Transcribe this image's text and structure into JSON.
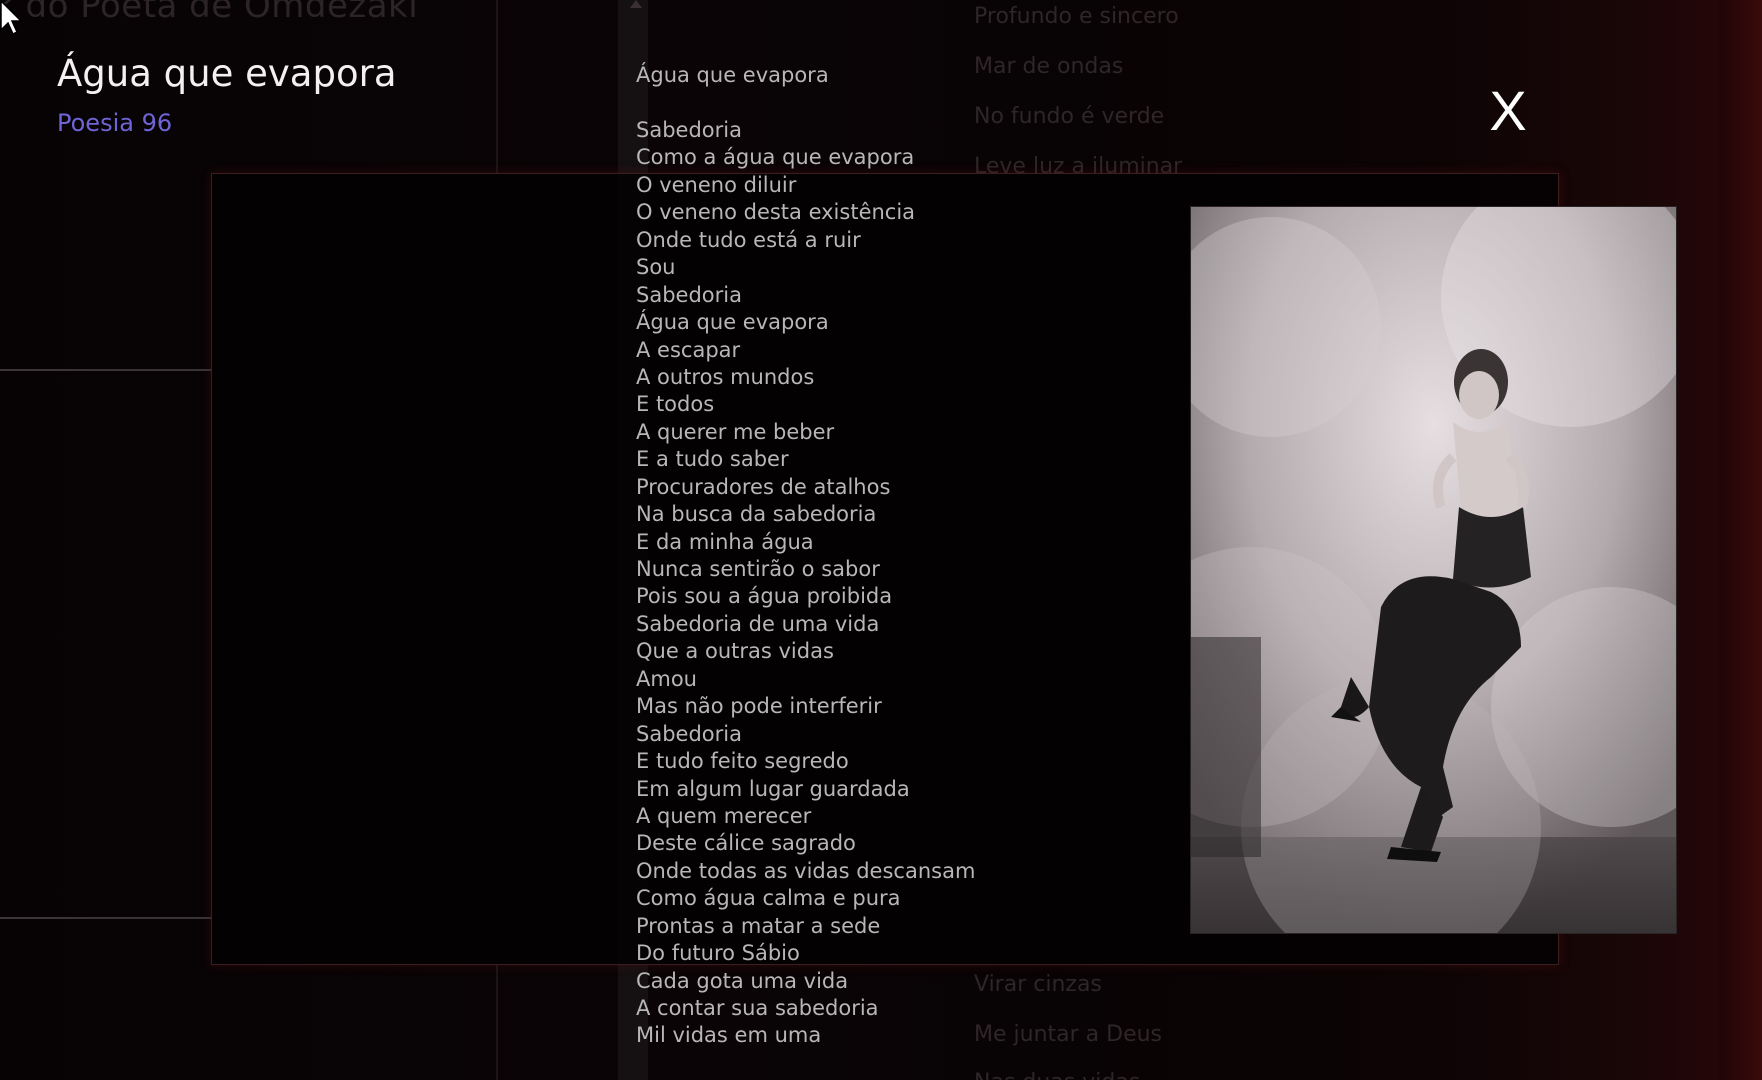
{
  "background": {
    "site_title": "k do Poeta de Omdezaki",
    "menu_top": [
      "Profundo e sincero",
      "Mar de ondas",
      "No fundo é verde",
      "Leve luz a iluminar"
    ],
    "menu_bottom": [
      "Virar cinzas",
      "Me juntar a Deus",
      "Nas duas vidas"
    ]
  },
  "header": {
    "title": "Água que evapora",
    "subtitle": "Poesia 96"
  },
  "close_label": "X",
  "photo": {
    "icon": "photo-woman-in-smoke"
  },
  "poem": {
    "heading": "Água que evapora",
    "lines": [
      "Sabedoria",
      "Como a água que evapora",
      "O veneno diluir",
      "O veneno desta existência",
      "Onde tudo está a ruir",
      "Sou",
      "Sabedoria",
      "Água que evapora",
      "A escapar",
      "A outros mundos",
      "E todos",
      "A querer me beber",
      "E a tudo saber",
      "Procuradores de atalhos",
      "Na busca da sabedoria",
      "E da minha água",
      "Nunca sentirão o sabor",
      "Pois sou a água proibida",
      "Sabedoria de uma vida",
      "Que a outras vidas",
      "Amou",
      "Mas não pode interferir",
      "Sabedoria",
      "E tudo feito segredo",
      "Em algum lugar guardada",
      "A quem merecer",
      "Deste cálice sagrado",
      "Onde todas as vidas descansam",
      "Como água calma e pura",
      "Prontas a matar a sede",
      "Do futuro Sábio",
      "Cada gota uma vida",
      "A contar sua sabedoria",
      "Mil vidas em uma"
    ]
  }
}
